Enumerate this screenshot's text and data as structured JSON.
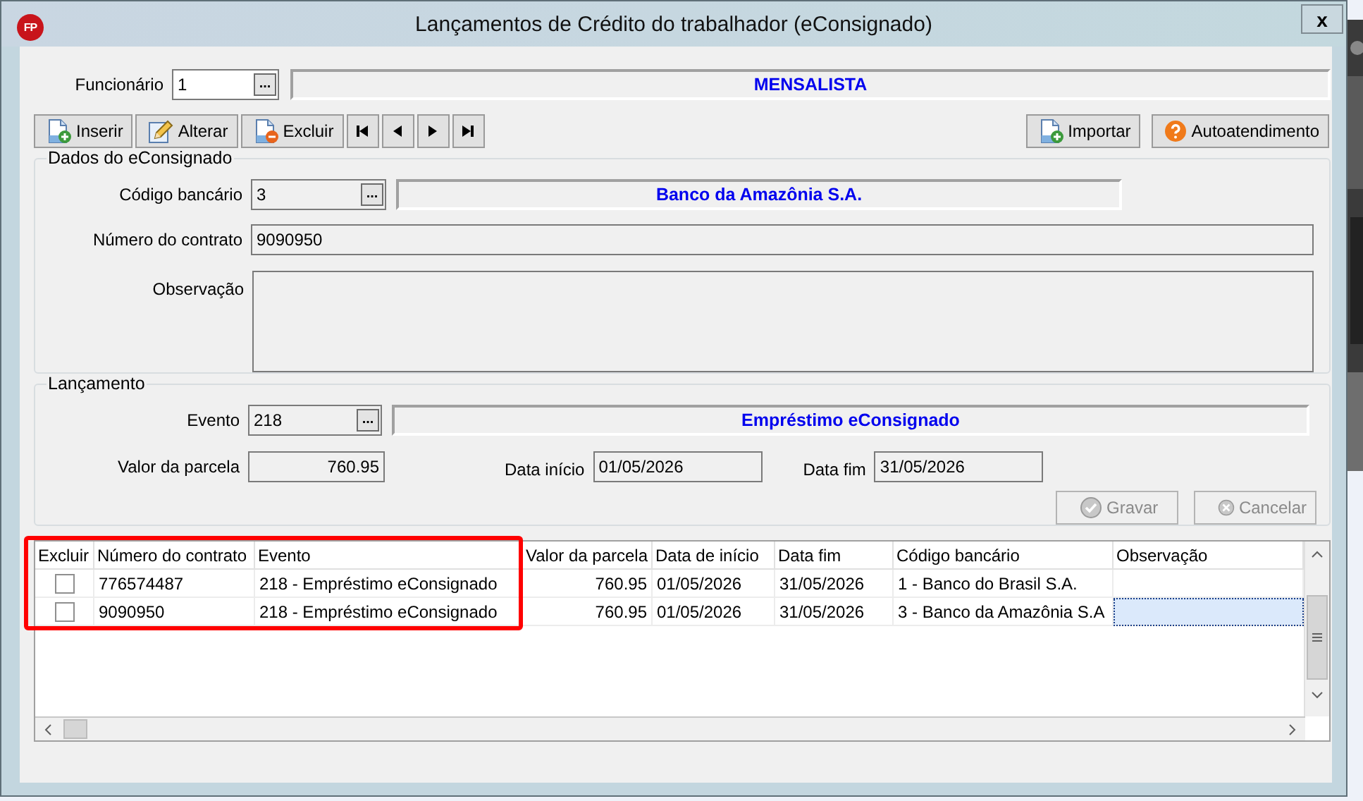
{
  "window": {
    "logo": "FP",
    "title": "Lançamentos de Crédito do trabalhador (eConsignado)",
    "close": "x"
  },
  "funcionario": {
    "label": "Funcionário",
    "value": "1",
    "button": "...",
    "description": "MENSALISTA"
  },
  "toolbar": {
    "left": [
      {
        "kind": "insert",
        "label": "Inserir"
      },
      {
        "kind": "edit",
        "label": "Alterar"
      },
      {
        "kind": "delete",
        "label": "Excluir"
      },
      {
        "kind": "first"
      },
      {
        "kind": "previous"
      },
      {
        "kind": "next"
      },
      {
        "kind": "last"
      }
    ],
    "right": [
      {
        "kind": "import",
        "label": "Importar"
      },
      {
        "kind": "help",
        "label": "Autoatendimento"
      }
    ]
  },
  "dados": {
    "title": "Dados do eConsignado",
    "fields": [
      {
        "kind": "lookup",
        "label": "Código bancário",
        "value": "3",
        "button": "...",
        "description": "Banco da Amazônia S.A."
      },
      {
        "kind": "text",
        "label": "Número do contrato",
        "value": "9090950"
      },
      {
        "kind": "memo",
        "label": "Observação"
      }
    ]
  },
  "lancamento": {
    "title": "Lançamento",
    "evento": {
      "label": "Evento",
      "value": "218",
      "button": "...",
      "description": "Empréstimo eConsignado"
    },
    "valor": {
      "label": "Valor da parcela",
      "value": "760.95"
    },
    "data_inicio": {
      "label": "Data início",
      "value": "01/05/2026"
    },
    "data_fim": {
      "label": "Data fim",
      "value": "31/05/2026"
    },
    "buttons": [
      {
        "kind": "save",
        "label": "Gravar",
        "disabled": true
      },
      {
        "kind": "cancel",
        "label": "Cancelar",
        "disabled": true
      }
    ]
  },
  "grid": {
    "columns": [
      "Excluir",
      "Número do contrato",
      "Evento",
      "Valor da parcela",
      "Data de início",
      "Data fim",
      "Código bancário",
      "Observação"
    ],
    "rows": [
      {
        "excluir": false,
        "contrato": "776574487",
        "evento": "218 - Empréstimo eConsignado",
        "valor": "760.95",
        "inicio": "01/05/2026",
        "fim": "31/05/2026",
        "banco": "1 - Banco do Brasil S.A.",
        "selected": false
      },
      {
        "excluir": false,
        "contrato": "9090950",
        "evento": "218 - Empréstimo eConsignado",
        "valor": "760.95",
        "inicio": "01/05/2026",
        "fim": "31/05/2026",
        "banco": "3 - Banco da Amazônia S.A",
        "selected": true
      }
    ],
    "highlighted": true
  }
}
